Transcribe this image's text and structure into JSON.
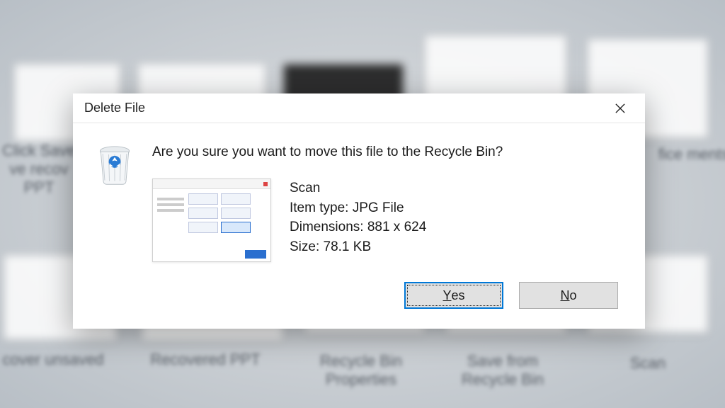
{
  "dialog": {
    "title": "Delete File",
    "prompt": "Are you sure you want to move this file to the Recycle Bin?",
    "file": {
      "name": "Scan",
      "type_label": "Item type: JPG File",
      "dimensions_label": "Dimensions: 881 x 624",
      "size_label": "Size: 78.1 KB"
    },
    "buttons": {
      "yes_pre": "",
      "yes_accel": "Y",
      "yes_post": "es",
      "no_pre": "",
      "no_accel": "N",
      "no_post": "o"
    }
  },
  "background": {
    "labels": [
      "Click Save\nve recov\nPPT",
      "fice\nments",
      "cover unsaved",
      "Recovered PPT",
      "Recycle Bin\nProperties",
      "Save from\nRecycle Bin",
      "Scan"
    ]
  }
}
